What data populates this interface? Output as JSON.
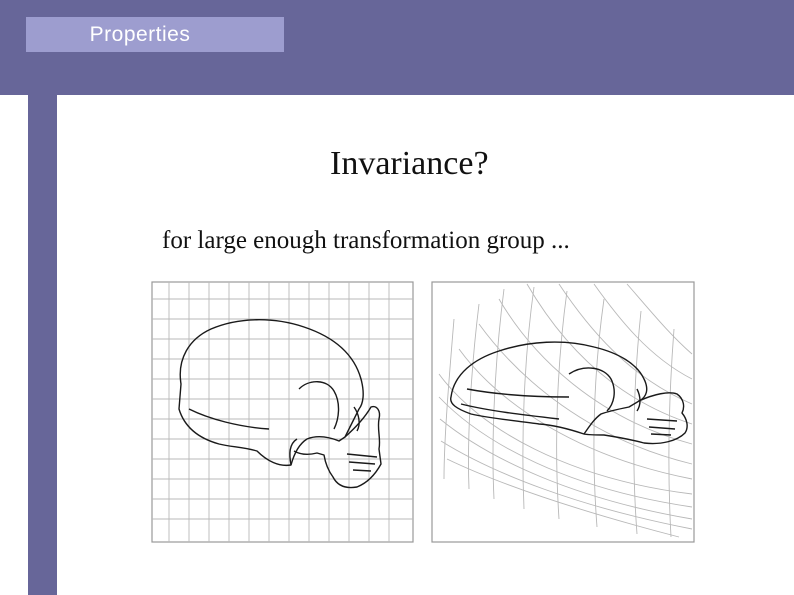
{
  "header": {
    "section_label": "Properties",
    "band_color": "#676699",
    "tab_color": "#9d9dcf"
  },
  "slide": {
    "title": "Invariance?",
    "subtitle": "for large enough transformation group ..."
  },
  "figure": {
    "panels": [
      {
        "name": "skull on square grid"
      },
      {
        "name": "skull on transformed grid"
      }
    ]
  }
}
